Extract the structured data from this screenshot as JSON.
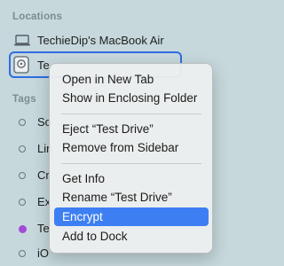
{
  "sidebar": {
    "locations_header": "Locations",
    "locations": [
      {
        "label": "TechieDip's MacBook Air",
        "icon": "laptop-icon"
      },
      {
        "label": "Te",
        "icon": "drive-icon"
      }
    ],
    "tags_header": "Tags",
    "tags": [
      {
        "label": "So",
        "color": "#ffffff"
      },
      {
        "label": "Lin",
        "color": "#ffffff"
      },
      {
        "label": "Cr",
        "color": "#ffffff"
      },
      {
        "label": "Ex",
        "color": "#ffffff"
      },
      {
        "label": "Te",
        "color": "#a24bd8"
      },
      {
        "label": "iO",
        "color": "#ffffff"
      }
    ]
  },
  "context_menu": {
    "items": [
      "Open in New Tab",
      "Show in Enclosing Folder",
      "Eject “Test Drive”",
      "Remove from Sidebar",
      "Get Info",
      "Rename “Test Drive”",
      "Encrypt",
      "Add to Dock"
    ],
    "highlighted": "Encrypt",
    "highlight_color": "#3d7ff2"
  }
}
